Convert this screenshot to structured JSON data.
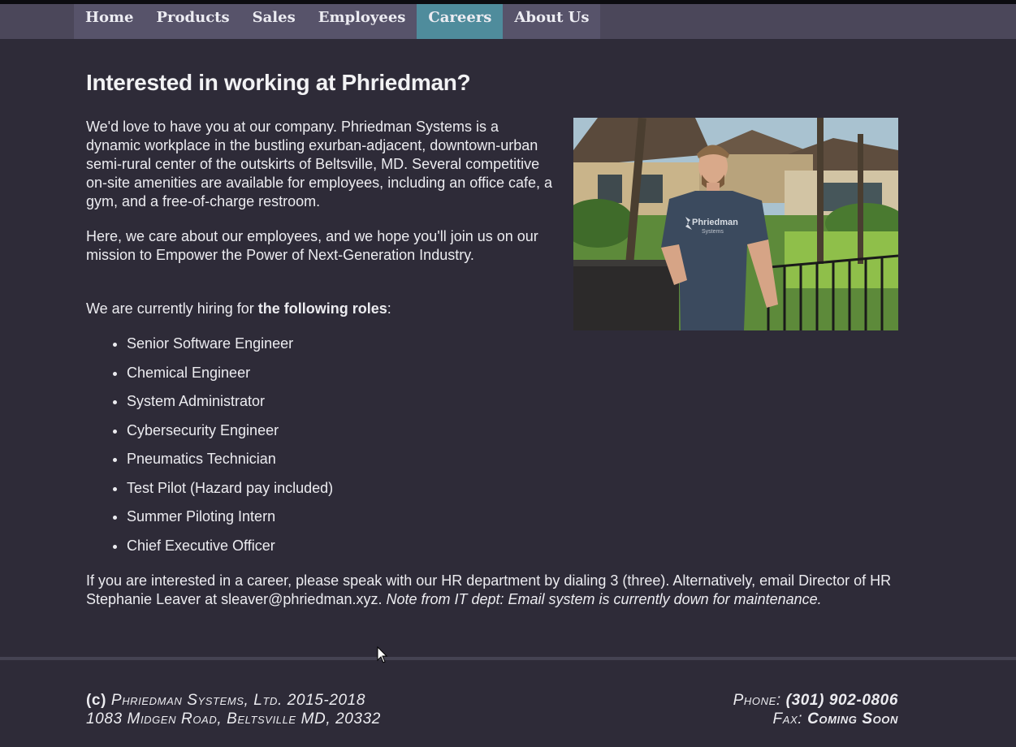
{
  "nav": {
    "items": [
      "Home",
      "Products",
      "Sales",
      "Employees",
      "Careers",
      "About Us"
    ],
    "active": "Careers"
  },
  "page": {
    "title": "Interested in working at Phriedman?",
    "intro": "We'd love to have you at our company. Phriedman Systems is a dynamic workplace in the bustling exurban-adjacent, downtown-urban semi-rural center of the outskirts of Beltsville, MD. Several competitive on-site amenities are available for employees, including an office cafe, a gym, and a free-of-charge restroom.",
    "mission": "Here, we care about our employees, and we hope you'll join us on our mission to Empower the Power of Next-Generation Industry.",
    "hiring_prefix": "We are currently hiring for ",
    "hiring_bold": "the following roles",
    "hiring_suffix": ":",
    "roles": [
      "Senior Software Engineer",
      "Chemical Engineer",
      "System Administrator",
      "Cybersecurity Engineer",
      "Pneumatics Technician",
      "Test Pilot (Hazard pay included)",
      "Summer Piloting Intern",
      "Chief Executive Officer"
    ],
    "contact_text": "If you are interested in a career, please speak with our HR department by dialing 3 (three). Alternatively, email Director of HR Stephanie Leaver at sleaver@phriedman.xyz. ",
    "contact_note": "Note from IT dept: Email system is currently down for maintenance.",
    "photo_shirt_text": "Phriedman",
    "photo_shirt_subtext": "Systems"
  },
  "footer": {
    "copyright_mark": "(c)",
    "company": "Phriedman Systems, Ltd. 2015-2018",
    "address": "1083 Midgen Road, Beltsville MD, 20332",
    "phone_label": "Phone: ",
    "phone": "(301) 902-0806",
    "fax_label": "Fax: ",
    "fax": "Coming Soon"
  },
  "colors": {
    "background": "#2e2b38",
    "nav_bar": "#4b475a",
    "nav_active": "#4f8c9c"
  }
}
